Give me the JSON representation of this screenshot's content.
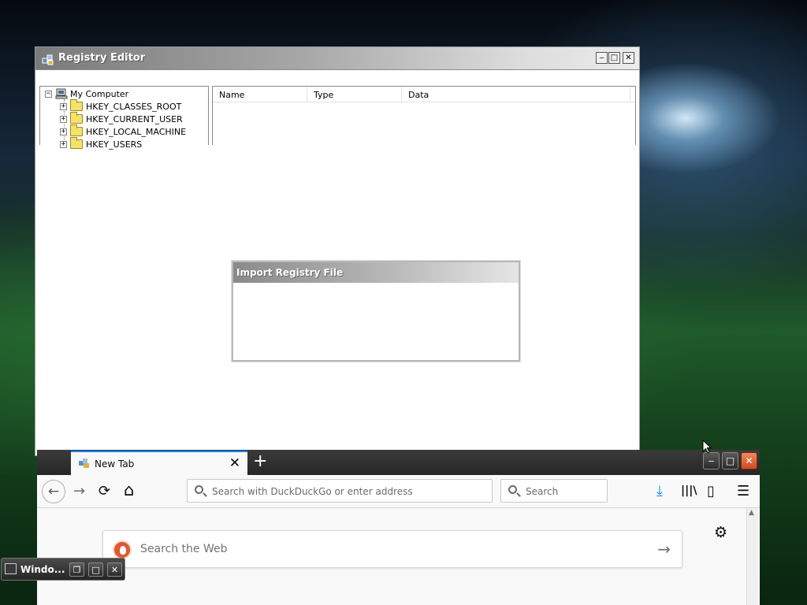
{
  "registry_editor": {
    "title": "Registry Editor",
    "window_controls": {
      "minimize": "‒",
      "maximize": "□",
      "close": "✕"
    },
    "tree": {
      "root": "My Computer",
      "root_expander": "−",
      "keys": [
        {
          "label": "HKEY_CLASSES_ROOT",
          "expander": "+"
        },
        {
          "label": "HKEY_CURRENT_USER",
          "expander": "+"
        },
        {
          "label": "HKEY_LOCAL_MACHINE",
          "expander": "+"
        },
        {
          "label": "HKEY_USERS",
          "expander": "+"
        }
      ]
    },
    "columns": [
      "Name",
      "Type",
      "Data"
    ]
  },
  "import_dialog": {
    "title": "Import Registry File"
  },
  "firefox": {
    "tab": {
      "label": "New Tab",
      "close": "✕"
    },
    "new_tab_button": "+",
    "window_controls": {
      "minimize": "‒",
      "maximize": "□",
      "close": "✕"
    },
    "toolbar": {
      "back": "←",
      "forward": "→",
      "reload": "⟳",
      "home": "⌂",
      "url_placeholder": "Search with DuckDuckGo or enter address",
      "search_placeholder": "Search",
      "downloads": "⤓",
      "library": "|||\\",
      "sidebar": "▯",
      "menu": "☰"
    },
    "content": {
      "web_search_placeholder": "Search the Web",
      "web_search_arrow": "→",
      "settings": "⚙"
    },
    "accent_color": "#0a84ff"
  },
  "taskbar": {
    "label": "Windo...",
    "buttons": {
      "restore": "❐",
      "maximize": "□",
      "close": "✕"
    }
  }
}
